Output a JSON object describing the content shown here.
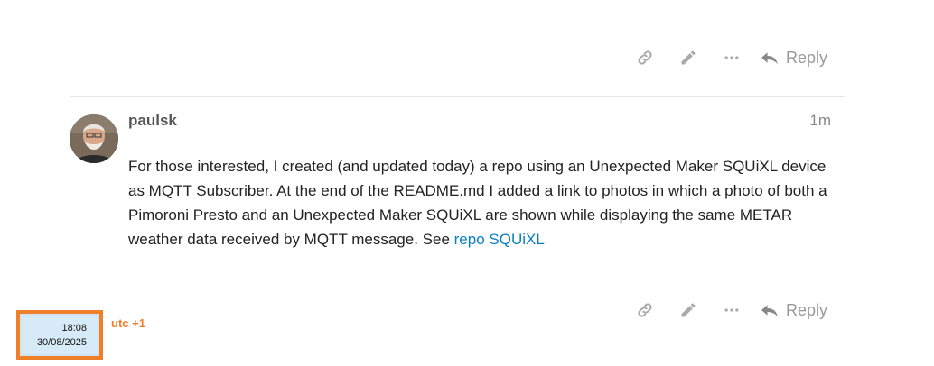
{
  "post_actions_top": {
    "link_icon": "link-icon",
    "edit_icon": "pencil-icon",
    "more_icon": "ellipsis-icon",
    "reply_label": "Reply"
  },
  "post": {
    "username": "paulsk",
    "time_ago": "1m",
    "body_text": "For those interested, I created (and updated today) a repo using an Unexpected Maker SQUiXL device as MQTT Subscriber. At the end of the README.md I added a link to photos in which a photo of both a Pimoroni Presto and an Unexpected Maker SQUiXL are shown while displaying the same METAR weather data received by MQTT message. See ",
    "link_text": "repo SQUiXL"
  },
  "post_actions_bottom": {
    "link_icon": "link-icon",
    "edit_icon": "pencil-icon",
    "more_icon": "ellipsis-icon",
    "reply_label": "Reply"
  },
  "taskbar_clock": {
    "time": "18:08",
    "date": "30/08/2025"
  },
  "timezone_label": "utc +1",
  "colors": {
    "link": "#0a7ec2",
    "icon_gray": "#999999",
    "clock_border": "#f07f2a",
    "clock_bg": "#d6eaf8"
  }
}
